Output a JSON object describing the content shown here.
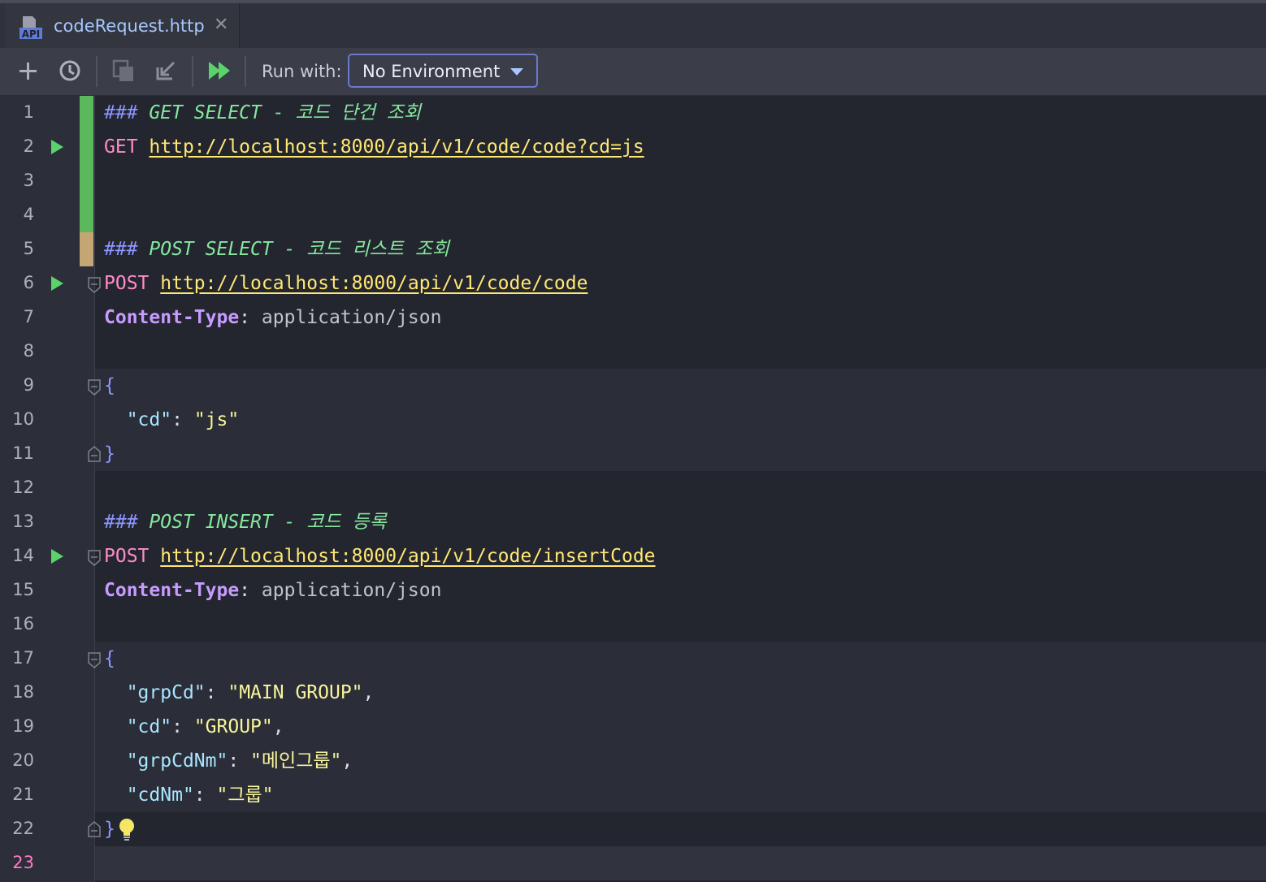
{
  "tab": {
    "title": "codeRequest.http",
    "icon": "api-file-icon",
    "icon_text": "API"
  },
  "toolbar": {
    "icons": [
      "add-icon",
      "history-icon",
      "copy-icon",
      "import-icon",
      "run-all-icon"
    ],
    "run_with_label": "Run with:",
    "environment": "No Environment"
  },
  "editor": {
    "current_line": 23,
    "lines": [
      {
        "n": "1"
      },
      {
        "n": "2"
      },
      {
        "n": "3"
      },
      {
        "n": "4"
      },
      {
        "n": "5"
      },
      {
        "n": "6"
      },
      {
        "n": "7"
      },
      {
        "n": "8"
      },
      {
        "n": "9"
      },
      {
        "n": "10"
      },
      {
        "n": "11"
      },
      {
        "n": "12"
      },
      {
        "n": "13"
      },
      {
        "n": "14"
      },
      {
        "n": "15"
      },
      {
        "n": "16"
      },
      {
        "n": "17"
      },
      {
        "n": "18"
      },
      {
        "n": "19"
      },
      {
        "n": "20"
      },
      {
        "n": "21"
      },
      {
        "n": "22"
      },
      {
        "n": "23"
      }
    ],
    "requests": [
      {
        "hash": "###",
        "comment": " GET SELECT - 코드 단건 조회",
        "method": "GET",
        "url": "http://localhost:8000/api/v1/code/code?cd=js"
      },
      {
        "hash": "###",
        "comment": " POST SELECT - 코드 리스트 조회",
        "method": "POST",
        "url": "http://localhost:8000/api/v1/code/code",
        "header_name": "Content-Type",
        "header_value": " application/json",
        "body_open": "{",
        "body": [
          {
            "key": "\"cd\"",
            "value": "\"js\"",
            "comma": ""
          }
        ],
        "body_close": "}"
      },
      {
        "hash": "###",
        "comment": " POST INSERT - 코드 등록",
        "method": "POST",
        "url": "http://localhost:8000/api/v1/code/insertCode",
        "header_name": "Content-Type",
        "header_value": " application/json",
        "body_open": "{",
        "body": [
          {
            "key": "\"grpCd\"",
            "value": "\"MAIN GROUP\"",
            "comma": ","
          },
          {
            "key": "\"cd\"",
            "value": "\"GROUP\"",
            "comma": ","
          },
          {
            "key": "\"grpCdNm\"",
            "value": "\"메인그룹\"",
            "comma": ","
          },
          {
            "key": "\"cdNm\"",
            "value": "\"그룹\"",
            "comma": ""
          }
        ],
        "body_close": "}"
      }
    ],
    "colon": ":",
    "space": " ",
    "indent": "  ",
    "comma": ","
  },
  "colors": {
    "accent": "#8e88ea",
    "run": "#59d36a",
    "vcs_added": "#5cb85c",
    "vcs_modified": "#c4a574"
  }
}
